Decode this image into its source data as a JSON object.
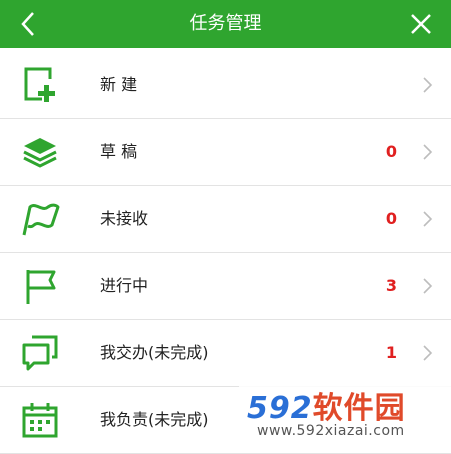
{
  "header": {
    "title": "任务管理",
    "back_icon": "chevron-left-icon",
    "close_icon": "close-icon"
  },
  "colors": {
    "header_bg": "#2fa52f",
    "icon_green": "#2fa52f",
    "count_red": "#e02020"
  },
  "menu": [
    {
      "label": "新 建",
      "count": "",
      "icon": "add-task-icon"
    },
    {
      "label": "草 稿",
      "count": "0",
      "icon": "layers-icon"
    },
    {
      "label": "未接收",
      "count": "0",
      "icon": "flag-wave-icon"
    },
    {
      "label": "进行中",
      "count": "3",
      "icon": "flag-icon"
    },
    {
      "label": "我交办(未完成)",
      "count": "1",
      "icon": "chat-bubbles-icon"
    },
    {
      "label": "我负责(未完成)",
      "count": "",
      "icon": "calendar-icon"
    }
  ],
  "watermark": {
    "logo_num": "592",
    "logo_text": "软件园",
    "url": "www.592xiazai.com"
  }
}
